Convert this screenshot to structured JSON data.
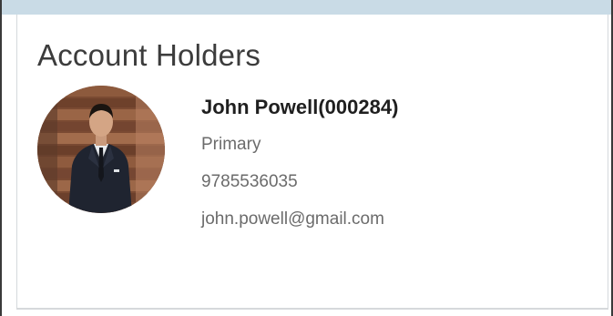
{
  "section": {
    "title": "Account Holders"
  },
  "holder": {
    "name": "John Powell(000284)",
    "role": "Primary",
    "phone": "9785536035",
    "email": "john.powell@gmail.com",
    "avatar_icon": "user-photo"
  },
  "colors": {
    "top_strip": "#c9dbe6",
    "title_text": "#3c3c3c",
    "name_text": "#1f1f1f",
    "detail_text": "#6b6b6b",
    "card_border": "#d5d9dc"
  }
}
